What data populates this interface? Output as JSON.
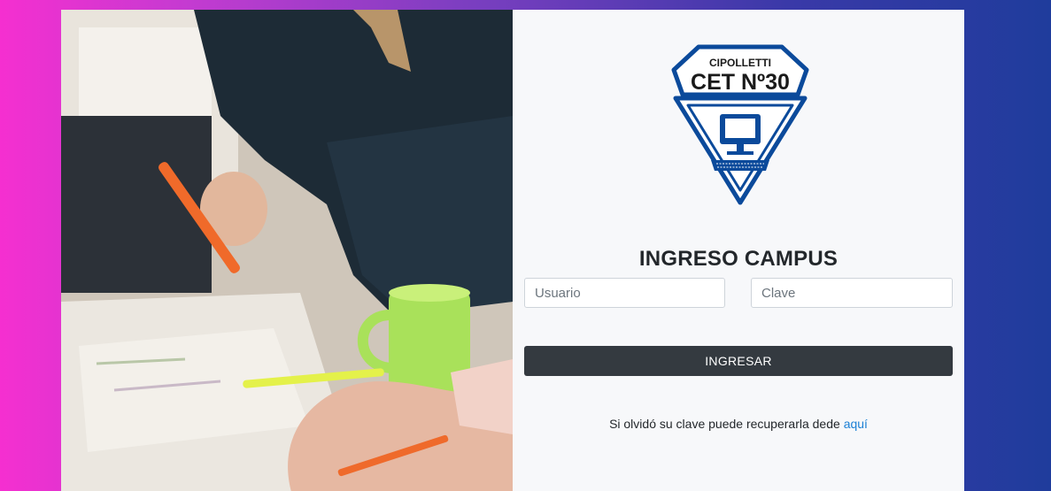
{
  "login": {
    "title": "INGRESO CAMPUS",
    "username_placeholder": "Usuario",
    "password_placeholder": "Clave",
    "submit_label": "INGRESAR",
    "recover_text": "Si olvidó su clave puede recuperarla dede",
    "recover_link": "aquí"
  },
  "logo": {
    "city": "CIPOLLETTI",
    "school": "CET Nº30",
    "icon": "computer-icon"
  },
  "colors": {
    "panel_bg": "#f7f8fa",
    "button_bg": "#343a40",
    "link": "#1a7fd4",
    "logo_blue": "#0b4a9b"
  }
}
